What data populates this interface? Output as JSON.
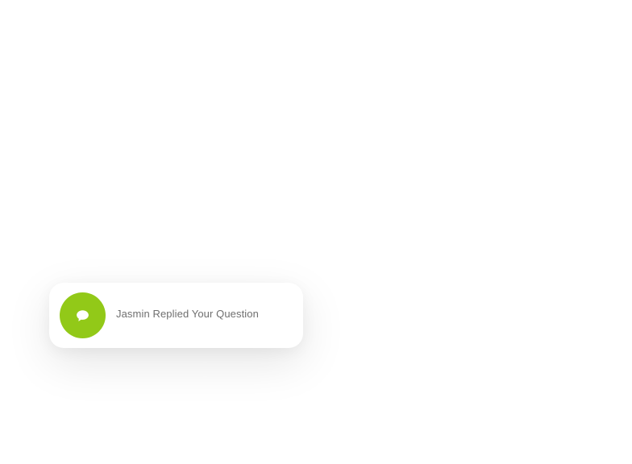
{
  "notification": {
    "icon": "chat-bubble-icon",
    "message": "Jasmin Replied Your Question",
    "accent_color": "#92c918"
  }
}
